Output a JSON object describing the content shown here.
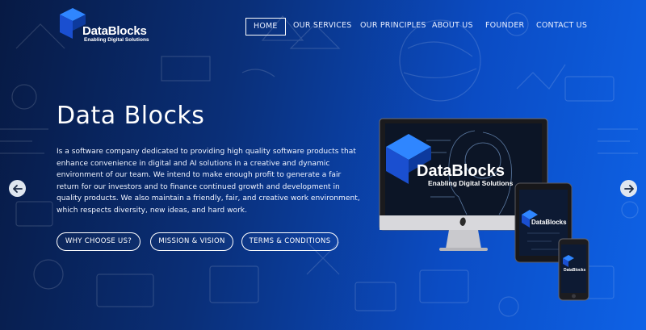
{
  "brand": {
    "name": "DataBlocks",
    "tagline": "Enabling Digital Solutions",
    "colors": {
      "logo_dark_blue": "#1a4fd0",
      "logo_light_blue": "#2f86ff"
    }
  },
  "nav": {
    "items": [
      {
        "label": "HOME",
        "active": true
      },
      {
        "label": "OUR SERVICES",
        "active": false
      },
      {
        "label": "OUR PRINCIPLES",
        "active": false
      },
      {
        "label": "ABOUT US",
        "active": false
      },
      {
        "label": "FOUNDER",
        "active": false
      },
      {
        "label": "CONTACT US",
        "active": false
      }
    ]
  },
  "hero": {
    "title": "Data Blocks",
    "description": "Is a software company dedicated to providing high quality software products that enhance convenience in digital and AI solutions in a creative and dynamic environment of our team. We intend to make enough profit to generate a fair return for our investors and to finance continued growth and development in quality products. We also maintain a friendly, fair, and creative work environment, which respects diversity, new ideas, and hard work.",
    "buttons": [
      "WHY CHOOSE US?",
      "MISSION & VISION",
      "TERMS & CONDITIONS"
    ]
  },
  "carousel": {
    "prev_icon": "arrow-left-icon",
    "next_icon": "arrow-right-icon"
  },
  "devices": {
    "monitor_brand": "DataBlocks",
    "monitor_tagline": "Enabling Digital Solutions",
    "tablet_brand": "DataBlocks",
    "phone_brand": "DataBlocks"
  },
  "theme": {
    "background_dark": "#071a44",
    "background_light": "#0e62e6",
    "text": "#ffffff"
  }
}
